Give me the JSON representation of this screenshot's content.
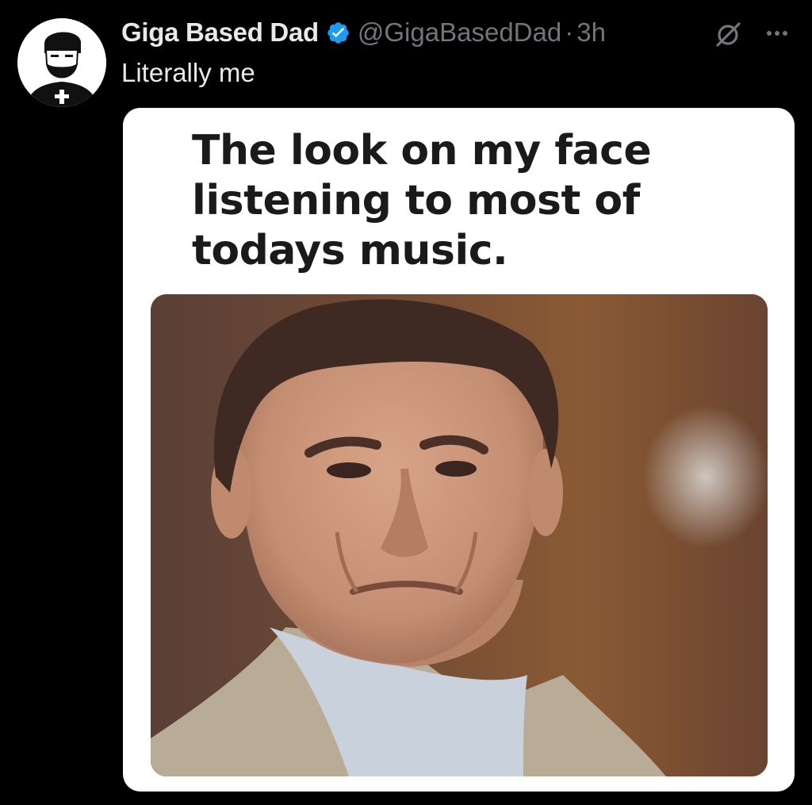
{
  "tweet": {
    "author": {
      "display_name": "Giga Based Dad",
      "handle": "@GigaBasedDad",
      "verified": true,
      "avatar_icon": "bearded-man-with-cross-avatar-icon"
    },
    "separator": "·",
    "time": "3h",
    "text": "Literally me",
    "actions": {
      "grok_icon": "grok-slash-icon",
      "more_icon": "more-horizontal-icon"
    },
    "media": {
      "caption": "The look on my face listening to most of todays music.",
      "photo_icon": "grimacing-man-photo"
    }
  },
  "colors": {
    "background": "#000000",
    "primary_text": "#e7e9ea",
    "secondary_text": "#71767b",
    "verified_badge": "#1d9bf0",
    "media_background": "#ffffff"
  }
}
